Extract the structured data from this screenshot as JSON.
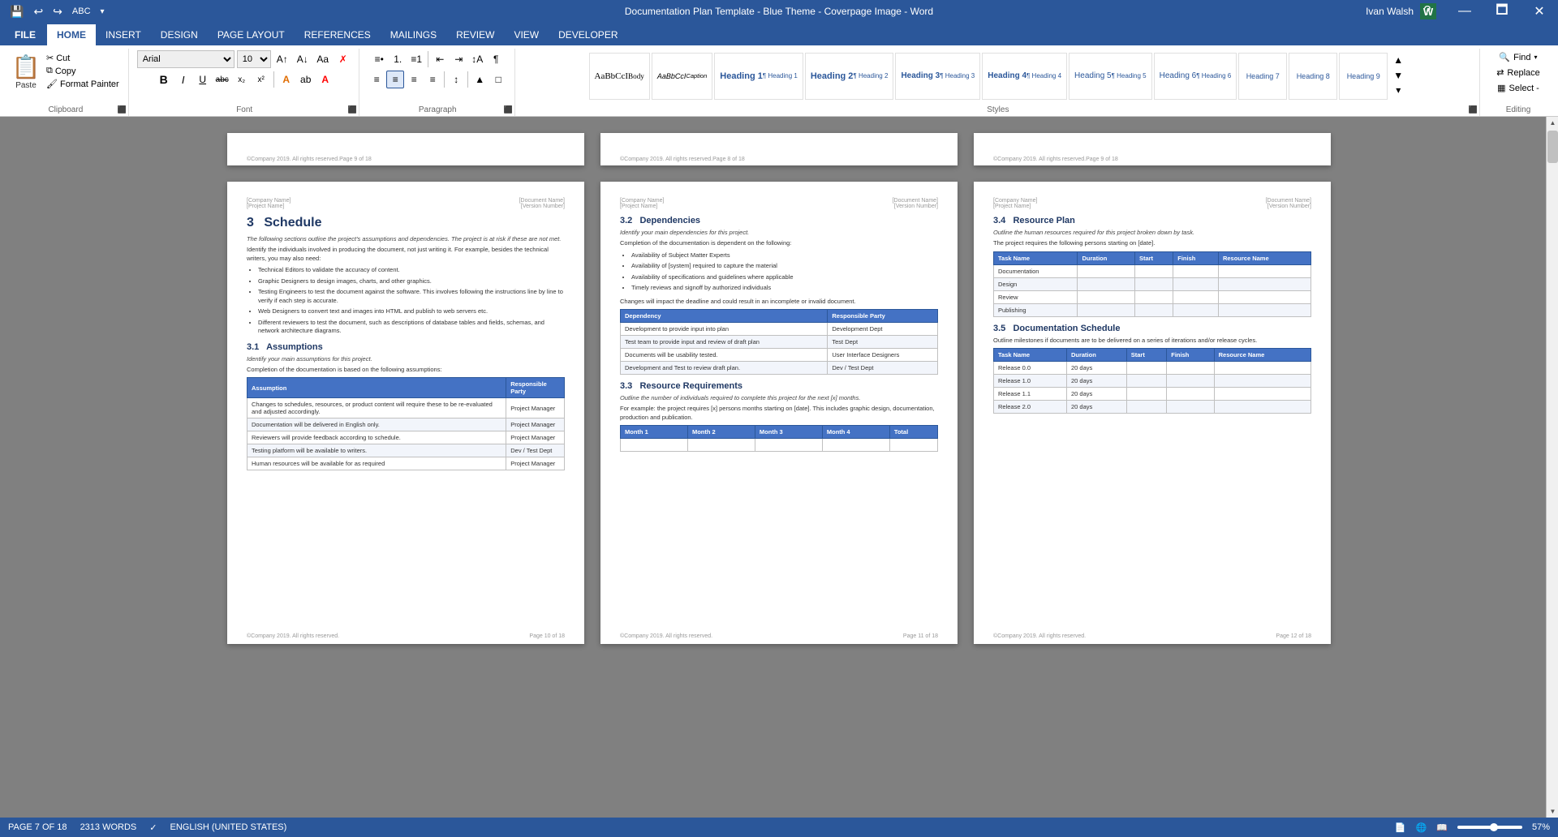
{
  "titleBar": {
    "title": "Documentation Plan Template - Blue Theme - Coverpage Image - Word",
    "quickAccess": [
      "💾",
      "↩",
      "↪",
      "ABC",
      "↓"
    ],
    "windowControls": [
      "?",
      "⬜",
      "—",
      "🗖",
      "✕"
    ],
    "user": "Ivan Walsh",
    "appLetter": "W"
  },
  "ribbon": {
    "tabs": [
      "FILE",
      "HOME",
      "INSERT",
      "DESIGN",
      "PAGE LAYOUT",
      "REFERENCES",
      "MAILINGS",
      "REVIEW",
      "VIEW",
      "DEVELOPER"
    ],
    "activeTab": "HOME",
    "clipboard": {
      "label": "Clipboard",
      "paste": "Paste",
      "cut": "Cut",
      "copy": "Copy",
      "formatPainter": "Format Painter"
    },
    "font": {
      "label": "Font",
      "fontName": "Arial",
      "fontSize": "10",
      "bold": "B",
      "italic": "I",
      "underline": "U",
      "strikethrough": "abc",
      "subscript": "x₂",
      "superscript": "x²",
      "growFont": "A↑",
      "shrinkFont": "A↓",
      "changeCaseBtn": "Aa",
      "clearFormatting": "✗",
      "fontColor": "A",
      "highlight": "ab"
    },
    "paragraph": {
      "label": "Paragraph",
      "bullets": "≡•",
      "numbering": "1.",
      "multilevel": "≡1",
      "decreaseIndent": "←",
      "increaseIndent": "→",
      "sort": "↕",
      "showMarks": "¶",
      "alignLeft": "≡",
      "alignCenter": "≡",
      "alignRight": "≡",
      "justify": "≡",
      "lineSpacing": "↕",
      "shading": "▲",
      "borders": "□"
    },
    "styles": {
      "label": "Styles",
      "items": [
        {
          "name": "Body",
          "preview": "AaBbCcI"
        },
        {
          "name": "Caption",
          "preview": "AaBbCcI"
        },
        {
          "name": "Heading 1",
          "preview": "Heading 1"
        },
        {
          "name": "Heading 2",
          "preview": "Heading 2"
        },
        {
          "name": "Heading 3",
          "preview": "Heading 3"
        },
        {
          "name": "Heading 4",
          "preview": "Heading 4"
        },
        {
          "name": "Heading 5",
          "preview": "Heading 5"
        },
        {
          "name": "Heading 6",
          "preview": "Heading 6"
        },
        {
          "name": "Heading 7",
          "preview": "Heading 7"
        },
        {
          "name": "Heading 8",
          "preview": "Heading 8"
        },
        {
          "name": "Heading 9",
          "preview": "Heading 9"
        }
      ]
    },
    "editing": {
      "label": "Editing",
      "find": "Find",
      "replace": "Replace",
      "select": "Select -"
    }
  },
  "pages": {
    "page7": {
      "header": {
        "left": "[Company Name]",
        "right": "[Document Name]",
        "leftSub": "[Project Name]",
        "rightSub": "[Version Number]"
      },
      "footer": {
        "left": "©Company 2019. All rights reserved.",
        "right": "Page 10 of 18"
      },
      "section": "3",
      "sectionTitle": "Schedule",
      "intro": "The following sections outline the project's assumptions and dependencies. The project is at risk if these are not met.",
      "bodyText": "Identify the individuals involved in producing the document, not just writing it. For example, besides the technical writers, you may also need:",
      "bullets": [
        "Technical Editors to validate the accuracy of content.",
        "Graphic Designers to design images, charts, and other graphics.",
        "Testing Engineers to test the document against the software. This involves following the instructions line by line to verify if each step is accurate.",
        "Web Designers to convert text and images into HTML and publish to web servers etc.",
        "Different reviewers to test the document, such as descriptions of database tables and fields, schemas, and network architecture diagrams."
      ],
      "sub1": "3.1",
      "sub1Title": "Assumptions",
      "sub1Italic": "Identify your main assumptions for this project.",
      "sub1Text": "Completion of the documentation is based on the following assumptions:",
      "assumptionsTable": {
        "headers": [
          "Assumption",
          "Responsible Party"
        ],
        "rows": [
          [
            "Changes to schedules, resources, or product content will require these to be re-evaluated and adjusted accordingly.",
            "Project Manager"
          ],
          [
            "Documentation will be delivered in English only.",
            "Project Manager"
          ],
          [
            "Reviewers will provide feedback according to schedule.",
            "Project Manager"
          ],
          [
            "Testing platform will be available to writers.",
            "Dev / Test Dept"
          ],
          [
            "Human resources will be available for as required",
            "Project Manager"
          ]
        ]
      }
    },
    "page8": {
      "header": {
        "left": "[Company Name]",
        "right": "[Document Name]",
        "leftSub": "[Project Name]",
        "rightSub": "[Version Number]"
      },
      "footer": {
        "left": "©Company 2019. All rights reserved.",
        "right": "Page 11 of 18"
      },
      "section": "3.2",
      "sectionTitle": "Dependencies",
      "italic": "Identify your main dependencies for this project.",
      "text1": "Completion of the documentation is dependent on the following:",
      "bullets": [
        "Availability of Subject Matter Experts",
        "Availability of [system] required to capture the material",
        "Availability of specifications and guidelines where applicable",
        "Timely reviews and signoff by authorized individuals"
      ],
      "text2": "Changes will impact the deadline and could result in an incomplete or invalid document.",
      "depsTable": {
        "headers": [
          "Dependency",
          "Responsible Party"
        ],
        "rows": [
          [
            "Development to provide input into plan",
            "Development Dept"
          ],
          [
            "Test team to provide input and review of draft plan",
            "Test Dept"
          ],
          [
            "Documents will be usability tested.",
            "User Interface Designers"
          ],
          [
            "Development and Test to review draft plan.",
            "Dev / Test Dept"
          ]
        ]
      },
      "sub2": "3.3",
      "sub2Title": "Resource Requirements",
      "sub2Italic": "Outline the number of individuals required to complete this project for the next [x] months.",
      "sub2Text": "For example: the project requires [x] persons months starting on [date]. This includes graphic design, documentation, production and publication.",
      "resourceTable": {
        "headers": [
          "Month 1",
          "Month 2",
          "Month 3",
          "Month 4",
          "Total"
        ],
        "rows": [
          []
        ]
      }
    },
    "page9": {
      "header": {
        "left": "[Company Name]",
        "right": "[Document Name]",
        "leftSub": "[Project Name]",
        "rightSub": "[Version Number]"
      },
      "footer": {
        "left": "©Company 2019. All rights reserved.",
        "right": "Page 12 of 18"
      },
      "section": "3.4",
      "sectionTitle": "Resource Plan",
      "introText": "Outline the human resources required for this project broken down by task.",
      "text1": "The project requires the following persons starting on [date].",
      "resourcePlanTable": {
        "headers": [
          "Task Name",
          "Duration",
          "Start",
          "Finish",
          "Resource Name"
        ],
        "rows": [
          [
            "Documentation",
            "",
            "",
            "",
            ""
          ],
          [
            "Design",
            "",
            "",
            "",
            ""
          ],
          [
            "Review",
            "",
            "",
            "",
            ""
          ],
          [
            "Publishing",
            "",
            "",
            "",
            ""
          ]
        ]
      },
      "sub2": "3.5",
      "sub2Title": "Documentation Schedule",
      "sub2Text": "Outline milestones if documents are to be delivered on a series of iterations and/or release cycles.",
      "scheduleTable": {
        "headers": [
          "Task Name",
          "Duration",
          "Start",
          "Finish",
          "Resource Name"
        ],
        "rows": [
          [
            "Release 0.0",
            "20 days",
            "",
            "",
            ""
          ],
          [
            "Release 1.0",
            "20 days",
            "",
            "",
            ""
          ],
          [
            "Release 1.1",
            "20 days",
            "",
            "",
            ""
          ],
          [
            "Release 2.0",
            "20 days",
            "",
            "",
            ""
          ]
        ]
      }
    }
  },
  "statusBar": {
    "pageInfo": "PAGE 7 OF 18",
    "wordCount": "2313 WORDS",
    "language": "ENGLISH (UNITED STATES)",
    "zoom": "57%"
  }
}
